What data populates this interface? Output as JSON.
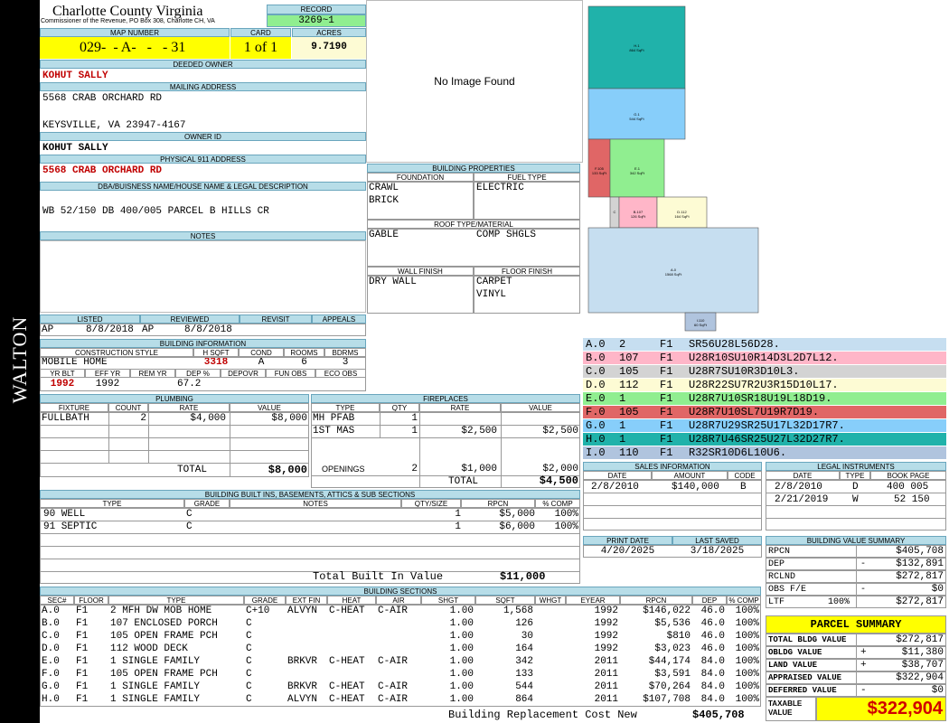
{
  "side_label": "WALTON",
  "header": {
    "county": "Charlotte County Virginia",
    "subtitle": "Commissioner of the Revenue, PO Box 308, Charlotte CH, VA",
    "record_label": "RECORD",
    "record_value": "3269~1",
    "map_number_label": "MAP NUMBER",
    "map_number": "029-  - A-   -   - 31",
    "card_label": "CARD",
    "card_value": "1 of 1",
    "acres_label": "ACRES",
    "acres_value": "9.7190"
  },
  "owner": {
    "deeded_owner_label": "DEEDED OWNER",
    "deeded_owner": "KOHUT SALLY",
    "mailing_label": "MAILING ADDRESS",
    "mailing_line1": "5568 CRAB ORCHARD RD",
    "mailing_line2": "KEYSVILLE, VA 23947-4167",
    "owner_id_label": "OWNER ID",
    "owner_id_value": "KOHUT SALLY",
    "physical_label": "PHYSICAL 911 ADDRESS",
    "physical_address": "5568 CRAB ORCHARD RD",
    "dba_label": "DBA/BUISNESS NAME/HOUSE NAME & LEGAL DESCRIPTION",
    "legal_description": "WB 52/150 DB 400/005 PARCEL B HILLS CR",
    "notes_label": "NOTES"
  },
  "image": {
    "no_image": "No Image Found"
  },
  "building_properties": {
    "title": "BUILDING PROPERTIES",
    "foundation_label": "FOUNDATION",
    "fuel_label": "FUEL TYPE",
    "foundation": [
      "CRAWL",
      "BRICK"
    ],
    "fuel": [
      "ELECTRIC"
    ],
    "roof_label": "ROOF TYPE/MATERIAL",
    "roof_type": "GABLE",
    "roof_material": "COMP SHGLS",
    "wall_label": "WALL FINISH",
    "floor_label": "FLOOR FINISH",
    "wall": [
      "DRY WALL"
    ],
    "floor": [
      "CARPET",
      "VINYL"
    ]
  },
  "review": {
    "listed_label": "LISTED",
    "reviewed_label": "REVIEWED",
    "revisit_label": "REVISIT",
    "appeals_label": "APPEALS",
    "listed_by": "AP",
    "listed_date": "8/8/2018",
    "reviewed_by": "AP",
    "reviewed_date": "8/8/2018"
  },
  "building_info": {
    "title": "BUILDING INFORMATION",
    "style_label": "CONSTRUCTION STYLE",
    "hsqft_label": "H SQFT",
    "cond_label": "COND",
    "rooms_label": "ROOMS",
    "bdrms_label": "BDRMS",
    "style": "MOBILE HOME",
    "hsqft": "3318",
    "cond": "A",
    "rooms": "6",
    "bdrms": "3",
    "yrblt_label": "YR BLT",
    "effyr_label": "EFF YR",
    "remyr_label": "REM YR",
    "dep_label": "DEP %",
    "depovr_label": "DEPOVR",
    "funobs_label": "FUN OBS",
    "ecoobs_label": "ECO OBS",
    "yrblt": "1992",
    "effyr": "1992",
    "dep": "67.2"
  },
  "plumbing": {
    "title": "PLUMBING",
    "headers": [
      "FIXTURE",
      "COUNT",
      "RATE",
      "VALUE"
    ],
    "rows": [
      [
        "FULLBATH",
        "2",
        "$4,000",
        "$8,000"
      ]
    ],
    "total_label": "TOTAL",
    "total": "$8,000"
  },
  "fireplaces": {
    "title": "FIREPLACES",
    "headers": [
      "TYPE",
      "QTY",
      "RATE",
      "VALUE"
    ],
    "rows": [
      [
        "MH PFAB",
        "1",
        "",
        ""
      ],
      [
        "1ST MAS",
        "1",
        "$2,500",
        "$2,500"
      ]
    ],
    "openings_label": "OPENINGS",
    "openings_qty": "2",
    "openings_rate": "$1,000",
    "openings_value": "$2,000",
    "total_label": "TOTAL",
    "total": "$4,500"
  },
  "built_ins": {
    "title": "BUILDING BUILT INS, BASEMENTS, ATTICS & SUB SECTIONS",
    "headers": [
      "TYPE",
      "GRADE",
      "NOTES",
      "QTY/SIZE",
      "RPCN",
      "% COMP"
    ],
    "rows": [
      [
        "90 WELL",
        "C",
        "",
        "1",
        "$5,000",
        "100%"
      ],
      [
        "91 SEPTIC",
        "C",
        "",
        "1",
        "$6,000",
        "100%"
      ]
    ],
    "total_label": "Total Built In Value",
    "total": "$11,000"
  },
  "sections": {
    "title": "BUILDING SECTIONS",
    "headers": [
      "SEC#",
      "FLOOR",
      "TYPE",
      "GRADE",
      "EXT FIN",
      "HEAT",
      "AIR",
      "SHGT",
      "SQFT",
      "WHGT",
      "EYEAR",
      "RPCN",
      "DEP",
      "% COMP"
    ],
    "rows": [
      [
        "A.0",
        "F1",
        "2 MFH DW MOB HOME",
        "C+10",
        "ALVYN",
        "C-HEAT",
        "C-AIR",
        "1.00",
        "1,568",
        "",
        "1992",
        "$146,022",
        "46.0",
        "100%"
      ],
      [
        "B.0",
        "F1",
        "107 ENCLOSED PORCH",
        "C",
        "",
        "",
        "",
        "1.00",
        "126",
        "",
        "1992",
        "$5,536",
        "46.0",
        "100%"
      ],
      [
        "C.0",
        "F1",
        "105 OPEN FRAME PCH",
        "C",
        "",
        "",
        "",
        "1.00",
        "30",
        "",
        "1992",
        "$810",
        "46.0",
        "100%"
      ],
      [
        "D.0",
        "F1",
        "112 WOOD DECK",
        "C",
        "",
        "",
        "",
        "1.00",
        "164",
        "",
        "1992",
        "$3,023",
        "46.0",
        "100%"
      ],
      [
        "E.0",
        "F1",
        "1 SINGLE FAMILY",
        "C",
        "BRKVR",
        "C-HEAT",
        "C-AIR",
        "1.00",
        "342",
        "",
        "2011",
        "$44,174",
        "84.0",
        "100%"
      ],
      [
        "F.0",
        "F1",
        "105 OPEN FRAME PCH",
        "C",
        "",
        "",
        "",
        "1.00",
        "133",
        "",
        "2011",
        "$3,591",
        "84.0",
        "100%"
      ],
      [
        "G.0",
        "F1",
        "1 SINGLE FAMILY",
        "C",
        "BRKVR",
        "C-HEAT",
        "C-AIR",
        "1.00",
        "544",
        "",
        "2011",
        "$70,264",
        "84.0",
        "100%"
      ],
      [
        "H.0",
        "F1",
        "1 SINGLE FAMILY",
        "C",
        "ALVYN",
        "C-HEAT",
        "C-AIR",
        "1.00",
        "864",
        "",
        "2011",
        "$107,708",
        "84.0",
        "100%"
      ]
    ],
    "replacement_label": "Building Replacement Cost New",
    "replacement_value": "$405,708"
  },
  "sketch": {
    "labels": {
      "a": "A.0\n1568 SqFt",
      "b": "B.107\n126 SqFt",
      "c": "C",
      "d": "D.112\n164 SqFt",
      "e": "E.1\n342 SqFt",
      "f": "F.105\n133 SqFt",
      "g": "G.1\n544 SqFt",
      "h": "H.1\n864 SqFt",
      "i": "I.110\n60 SqFt"
    },
    "codes": [
      {
        "sec": "A.0",
        "id": "2",
        "floor": "F1",
        "code": "SR56U28L56D28.",
        "color": "#c6def0"
      },
      {
        "sec": "B.0",
        "id": "107",
        "floor": "F1",
        "code": "U28R10SU10R14D3L2D7L12.",
        "color": "#ffb6c8"
      },
      {
        "sec": "C.0",
        "id": "105",
        "floor": "F1",
        "code": "U28R7SU10R3D10L3.",
        "color": "#d3d3d3"
      },
      {
        "sec": "D.0",
        "id": "112",
        "floor": "F1",
        "code": "U28R22SU7R2U3R15D10L17.",
        "color": "#fdfbd4"
      },
      {
        "sec": "E.0",
        "id": "1",
        "floor": "F1",
        "code": "U28R7U10SR18U19L18D19.",
        "color": "#90ee90"
      },
      {
        "sec": "F.0",
        "id": "105",
        "floor": "F1",
        "code": "U28R7U10SL7U19R7D19.",
        "color": "#e06666"
      },
      {
        "sec": "G.0",
        "id": "1",
        "floor": "F1",
        "code": "U28R7U29SR25U17L32D17R7.",
        "color": "#87cefa"
      },
      {
        "sec": "H.0",
        "id": "1",
        "floor": "F1",
        "code": "U28R7U46SR25U27L32D27R7.",
        "color": "#20b2aa"
      },
      {
        "sec": "I.0",
        "id": "110",
        "floor": "F1",
        "code": "R32SR10D6L10U6.",
        "color": "#b0c4de"
      }
    ]
  },
  "sales": {
    "title": "SALES INFORMATION",
    "headers": [
      "DATE",
      "AMOUNT",
      "CODE"
    ],
    "rows": [
      [
        "2/8/2010",
        "$140,000",
        "B"
      ]
    ]
  },
  "legal": {
    "title": "LEGAL INSTRUMENTS",
    "headers": [
      "DATE",
      "TYPE",
      "BOOK PAGE"
    ],
    "rows": [
      [
        "2/8/2010",
        "D",
        "400 005"
      ],
      [
        "2/21/2019",
        "W",
        "52 150"
      ]
    ]
  },
  "print": {
    "print_label": "PRINT DATE",
    "saved_label": "LAST SAVED",
    "print_date": "4/20/2025",
    "saved_date": "3/18/2025"
  },
  "value_summary": {
    "title": "BUILDING VALUE SUMMARY",
    "rows": [
      {
        "label": "RPCN",
        "sign": "",
        "value": "$405,708"
      },
      {
        "label": "DEP",
        "sign": "-",
        "value": "$132,891"
      },
      {
        "label": "RCLND",
        "sign": "",
        "value": "$272,817"
      },
      {
        "label": "OBS F/E",
        "sign": "-",
        "value": "$0"
      },
      {
        "label": "LTF",
        "pct": "100%",
        "sign": "",
        "value": "$272,817"
      }
    ]
  },
  "parcel": {
    "title": "PARCEL SUMMARY",
    "rows": [
      {
        "label": "TOTAL BLDG VALUE",
        "sign": "",
        "value": "$272,817"
      },
      {
        "label": "OBLDG VALUE",
        "sign": "+",
        "value": "$11,380"
      },
      {
        "label": "LAND VALUE",
        "sign": "+",
        "value": "$38,707"
      },
      {
        "label": "APPRAISED VALUE",
        "sign": "",
        "value": "$322,904"
      },
      {
        "label": "DEFERRED VALUE",
        "sign": "-",
        "value": "$0"
      }
    ],
    "taxable_label": "TAXABLE VALUE",
    "taxable_value": "$322,904"
  }
}
